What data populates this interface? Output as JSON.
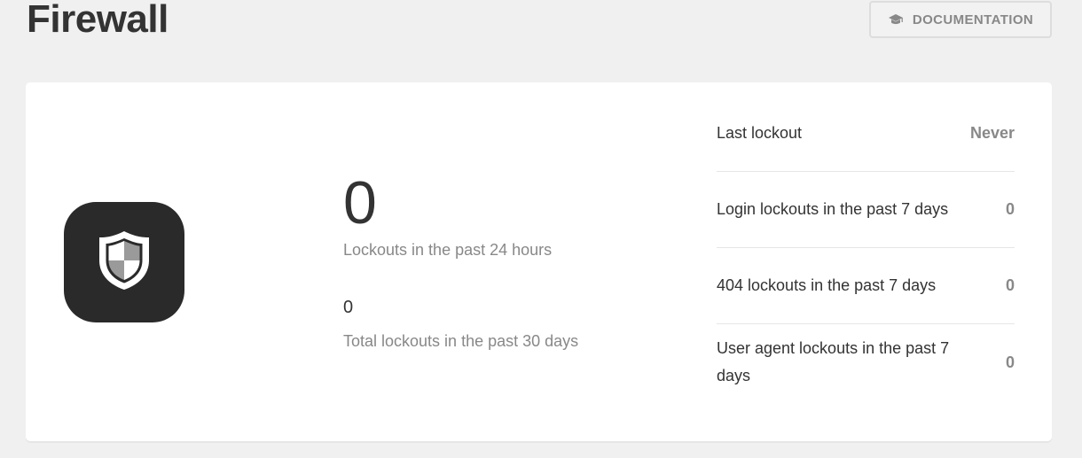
{
  "header": {
    "title": "Firewall",
    "documentation_button": {
      "label": "DOCUMENTATION",
      "icon": "graduation-cap-icon"
    }
  },
  "summary": {
    "icon": "shield-icon",
    "lockouts_24h": {
      "value": "0",
      "label": "Lockouts in the past 24 hours"
    },
    "lockouts_30d": {
      "value": "0",
      "label": "Total lockouts in the past 30 days"
    },
    "rows": [
      {
        "label": "Last lockout",
        "value": "Never"
      },
      {
        "label": "Login lockouts in the past 7 days",
        "value": "0"
      },
      {
        "label": "404 lockouts in the past 7 days",
        "value": "0"
      },
      {
        "label": "User agent lockouts in the past 7 days",
        "value": "0"
      }
    ]
  },
  "colors": {
    "page_background": "#f0f0f0",
    "card_background": "#ffffff",
    "heading_text": "#333333",
    "muted_text": "#888888",
    "icon_tile": "#2a2a2b"
  }
}
